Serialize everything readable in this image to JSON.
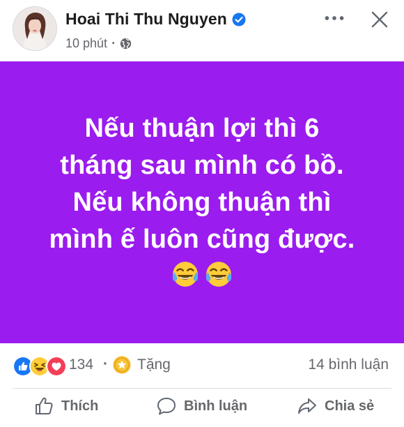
{
  "post": {
    "author": "Hoai Thi Thu Nguyen",
    "time": "10 phút",
    "time_separator": "·",
    "text_lines": [
      "Nếu thuận lợi thì 6",
      "tháng sau mình có bồ.",
      "Nếu không thuận thì",
      "mình ế luôn cũng được."
    ],
    "background_color": "#9b1cee"
  },
  "stats": {
    "reaction_count": "134",
    "separator": "·",
    "gift_label": "Tặng",
    "comment_count": "14 bình luận"
  },
  "actions": {
    "like": "Thích",
    "comment": "Bình luận",
    "share": "Chia sẻ"
  },
  "icons": {
    "verified": "verified-badge-icon",
    "globe": "globe-icon",
    "more": "more-dots-icon",
    "close": "close-icon",
    "reactions": [
      "like-reaction-icon",
      "haha-reaction-icon",
      "love-reaction-icon"
    ],
    "gift": "star-gift-icon",
    "post_emoji": [
      "tears-of-joy-emoji",
      "tears-of-joy-emoji"
    ]
  },
  "colors": {
    "accent": "#1877f2",
    "secondary_text": "#65676b"
  }
}
